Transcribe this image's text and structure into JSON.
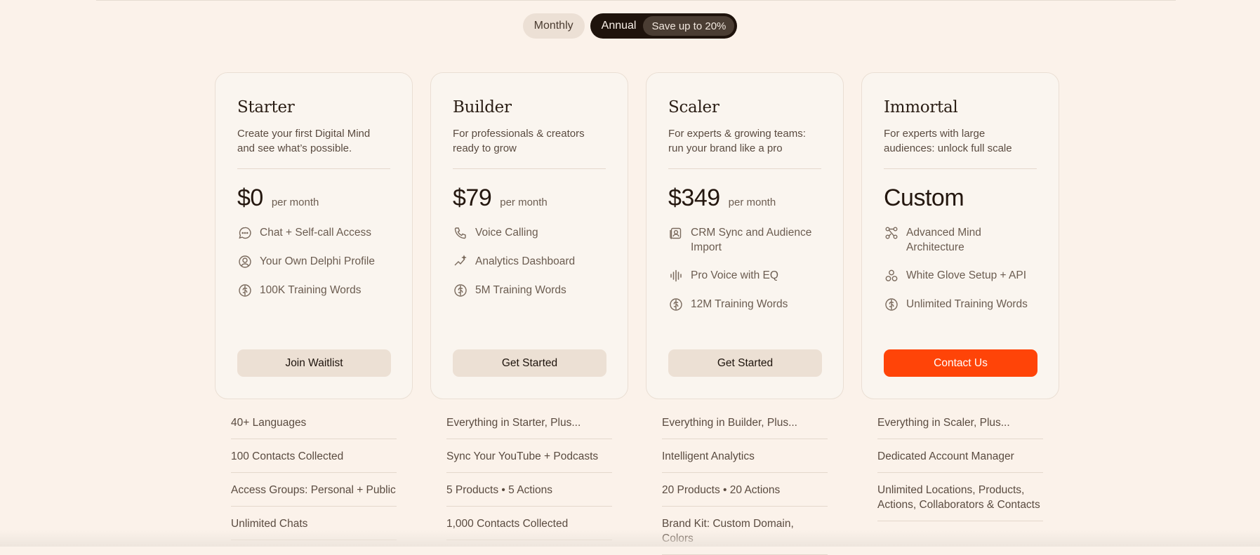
{
  "billing_toggle": {
    "monthly_label": "Monthly",
    "annual_label": "Annual",
    "save_badge": "Save up to 20%",
    "selected": "Annual"
  },
  "plans": [
    {
      "name": "Starter",
      "description": "Create your first Digital Mind and see what’s possible.",
      "price": "$0",
      "period": "per month",
      "features": [
        {
          "icon": "chat-bubble-icon",
          "label": "Chat + Self-call Access"
        },
        {
          "icon": "user-circle-icon",
          "label": "Your Own Delphi Profile"
        },
        {
          "icon": "brain-icon",
          "label": "100K Training Words"
        }
      ],
      "cta": "Join Waitlist",
      "included": [
        "40+ Languages",
        "100 Contacts Collected",
        "Access Groups: Personal + Public",
        "Unlimited Chats"
      ]
    },
    {
      "name": "Builder",
      "description": "For professionals & creators ready to grow",
      "price": "$79",
      "period": "per month",
      "features": [
        {
          "icon": "phone-icon",
          "label": "Voice Calling"
        },
        {
          "icon": "sparkle-chart-icon",
          "label": "Analytics Dashboard"
        },
        {
          "icon": "brain-icon",
          "label": "5M Training Words"
        }
      ],
      "cta": "Get Started",
      "included": [
        "Everything in Starter, Plus...",
        "Sync Your YouTube + Podcasts",
        "5 Products • 5 Actions",
        "1,000 Contacts Collected"
      ]
    },
    {
      "name": "Scaler",
      "description": "For experts & growing teams: run your brand like a pro",
      "price": "$349",
      "period": "per month",
      "features": [
        {
          "icon": "contact-card-icon",
          "label": "CRM Sync and Audience Import"
        },
        {
          "icon": "waveform-icon",
          "label": "Pro Voice with EQ"
        },
        {
          "icon": "brain-icon",
          "label": "12M Training Words"
        }
      ],
      "cta": "Get Started",
      "included": [
        "Everything in Builder, Plus...",
        "Intelligent Analytics",
        "20 Products • 20 Actions",
        "Brand Kit: Custom Domain, Colors"
      ]
    },
    {
      "name": "Immortal",
      "description": "For experts with large audiences: unlock full scale",
      "price": "Custom",
      "period": "",
      "features": [
        {
          "icon": "network-icon",
          "label": "Advanced Mind Architecture"
        },
        {
          "icon": "circles-icon",
          "label": "White Glove Setup + API"
        },
        {
          "icon": "brain-icon",
          "label": "Unlimited Training Words"
        }
      ],
      "cta": "Contact Us",
      "included": [
        "Everything in Scaler, Plus...",
        "Dedicated Account Manager",
        "Unlimited Locations, Products, Actions, Collaborators & Contacts"
      ]
    }
  ],
  "colors": {
    "background": "#fbf2ea",
    "card": "#faf5ef",
    "accent": "#ff4408",
    "toggle_active": "#1e130c"
  }
}
